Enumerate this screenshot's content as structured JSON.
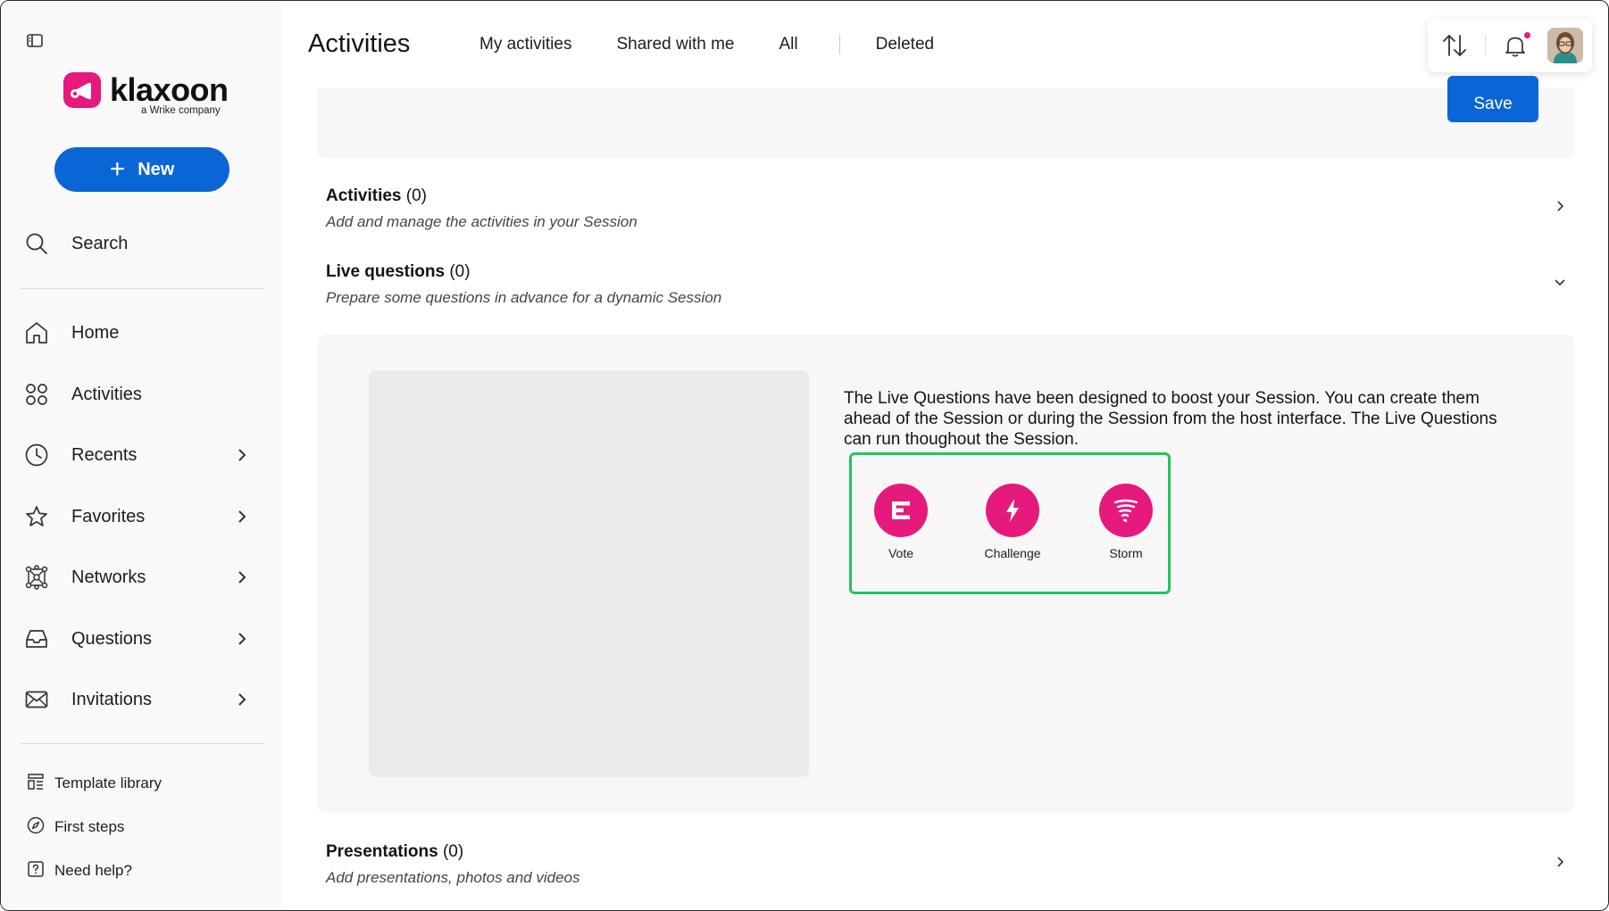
{
  "app": {
    "brand": "klaxoon",
    "brand_sub": "a Wrike company",
    "brand_color": "#e6197c",
    "accent_color": "#0a66d6"
  },
  "sidebar": {
    "new_label": "New",
    "search_label": "Search",
    "items": [
      {
        "label": "Home",
        "icon": "home-icon"
      },
      {
        "label": "Activities",
        "icon": "activities-icon"
      },
      {
        "label": "Recents",
        "icon": "clock-icon"
      },
      {
        "label": "Favorites",
        "icon": "star-icon"
      },
      {
        "label": "Networks",
        "icon": "network-icon"
      },
      {
        "label": "Questions",
        "icon": "inbox-icon"
      },
      {
        "label": "Invitations",
        "icon": "mail-icon"
      }
    ],
    "footer": [
      {
        "label": "Template library",
        "icon": "template-icon"
      },
      {
        "label": "First steps",
        "icon": "compass-icon"
      },
      {
        "label": "Need help?",
        "icon": "help-icon"
      }
    ]
  },
  "header": {
    "title": "Activities",
    "tabs": [
      "My activities",
      "Shared with me",
      "All",
      "Deleted"
    ]
  },
  "content": {
    "save_label": "Save",
    "sections": {
      "activities": {
        "title": "Activities",
        "count": "(0)",
        "desc": "Add and manage the activities in your Session"
      },
      "live_questions": {
        "title": "Live questions",
        "count": "(0)",
        "desc": "Prepare some questions in advance for a dynamic Session"
      },
      "presentations": {
        "title": "Presentations",
        "count": "(0)",
        "desc": "Add presentations, photos and videos"
      }
    },
    "live_questions_text": "The Live Questions have been designed to boost your Session. You can create them ahead of the Session or during the Session from the host interface. The Live Questions can run thoughout the Session.",
    "question_types": [
      {
        "label": "Vote",
        "icon": "vote-icon"
      },
      {
        "label": "Challenge",
        "icon": "lightning-icon"
      },
      {
        "label": "Storm",
        "icon": "tornado-icon"
      }
    ],
    "highlight_color": "#22c55e"
  }
}
